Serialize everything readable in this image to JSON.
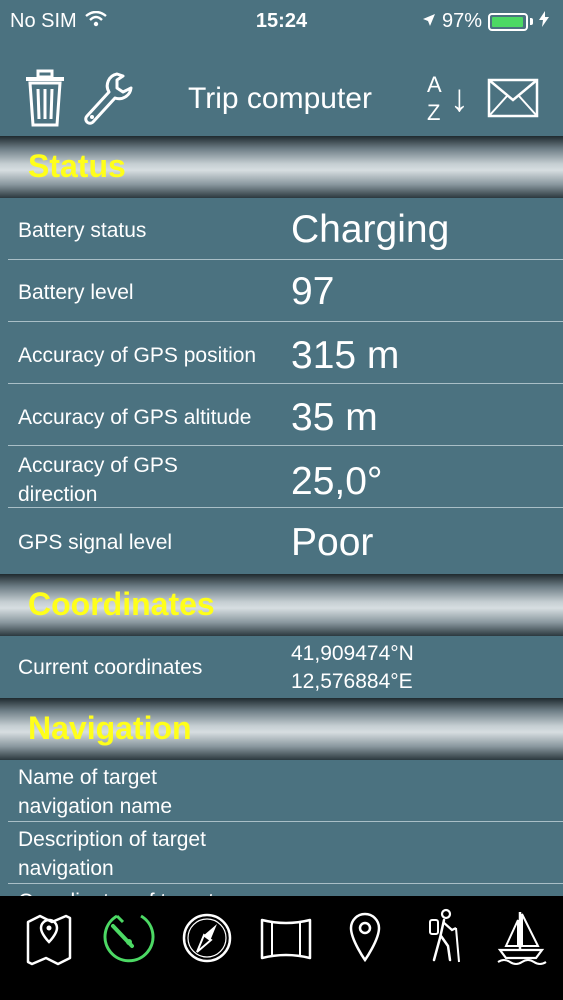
{
  "status_bar": {
    "carrier": "No SIM",
    "time": "15:24",
    "battery": "97%",
    "battery_level": 0.97
  },
  "toolbar": {
    "title": "Trip computer",
    "sort_top": "A",
    "sort_bottom": "Z",
    "sort_arrow": "↓"
  },
  "sections": {
    "status": {
      "title": "Status",
      "rows": [
        {
          "label": "Battery status",
          "value": "Charging"
        },
        {
          "label": "Battery level",
          "value": "97"
        },
        {
          "label": "Accuracy of GPS position",
          "value": "315 m"
        },
        {
          "label": "Accuracy of GPS altitude",
          "value": "35 m"
        },
        {
          "label_line1": "Accuracy of GPS",
          "label_line2": "direction",
          "value": "25,0°"
        },
        {
          "label": "GPS signal level",
          "value": "Poor"
        }
      ]
    },
    "coordinates": {
      "title": "Coordinates",
      "rows": [
        {
          "label": "Current coordinates",
          "lat": "41,909474°N",
          "lon": "12,576884°E"
        }
      ]
    },
    "navigation": {
      "title": "Navigation",
      "rows": [
        {
          "label_line1": "Name of target",
          "label_line2": "navigation name"
        },
        {
          "label_line1": "Description of target",
          "label_line2": "navigation"
        },
        {
          "label_line1": "Coordinates of target"
        }
      ]
    }
  },
  "icons": {
    "toolbar": [
      "trash-icon",
      "wrench-icon",
      "sort-az-icon",
      "mail-icon"
    ],
    "tabs": [
      "map-icon",
      "trip-computer-icon",
      "compass-icon",
      "panorama-icon",
      "location-pin-icon",
      "hiker-icon",
      "sailboat-icon"
    ]
  },
  "colors": {
    "background": "#4b7280",
    "section_title": "#ffff1a",
    "active_tab": "#4cd964",
    "tab_bar": "#000000"
  }
}
